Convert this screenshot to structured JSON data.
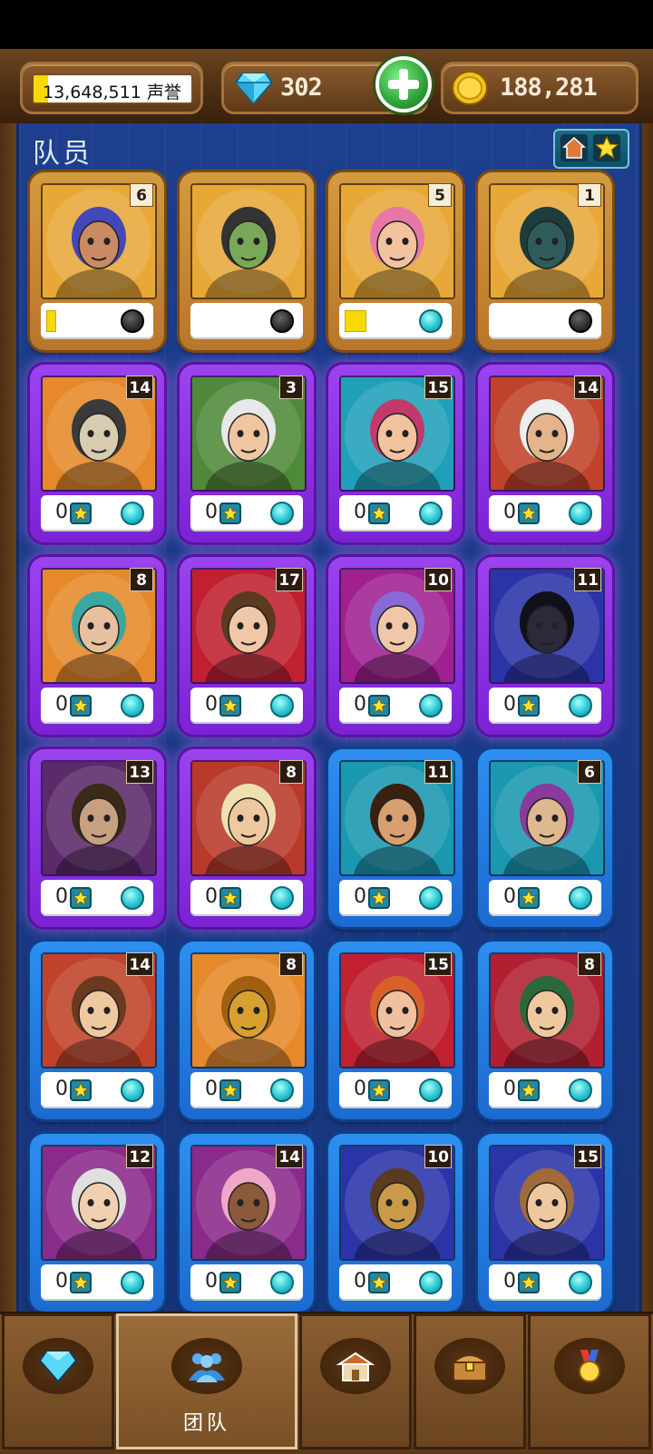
{
  "topbar": {
    "reputation": "13,648,511 声誉",
    "reputation_progress": 0.09,
    "gems": "302",
    "gold": "188,281",
    "icons": {
      "gem": "gem-icon",
      "gold": "gold-coin-icon",
      "plus": "plus-icon"
    }
  },
  "panel": {
    "title": "队员"
  },
  "filter": {
    "icons": [
      "home-icon",
      "star-icon"
    ]
  },
  "cards": [
    {
      "level": "6",
      "stars": "",
      "rarity": "gold",
      "progress": 0.14,
      "orb": "dark",
      "bg": "#e8a838",
      "skin": "#c98a64",
      "hair": "#4248b8"
    },
    {
      "level": "",
      "stars": "",
      "rarity": "gold",
      "progress": 0,
      "orb": "dark",
      "bg": "#e8a838",
      "skin": "#7aa85a",
      "hair": "#333"
    },
    {
      "level": "5",
      "stars": "",
      "rarity": "gold",
      "progress": 0.3,
      "orb": "cyan",
      "bg": "#e8a838",
      "skin": "#f3c3a0",
      "hair": "#e877a8"
    },
    {
      "level": "1",
      "stars": "",
      "rarity": "gold",
      "progress": 0,
      "orb": "dark",
      "bg": "#e8a838",
      "skin": "#2f5b5b",
      "hair": "#1e3c3c"
    },
    {
      "level": "14",
      "stars": "0",
      "rarity": "purple",
      "orb": "cyan",
      "bg": "#e5892a",
      "skin": "#d8ccb0",
      "hair": "#3a3a3a"
    },
    {
      "level": "3",
      "stars": "0",
      "rarity": "purple",
      "orb": "cyan",
      "bg": "#4f8a3a",
      "skin": "#f0c6a0",
      "hair": "#e8e8e8"
    },
    {
      "level": "15",
      "stars": "0",
      "rarity": "purple",
      "orb": "cyan",
      "bg": "#1fa0b8",
      "skin": "#f3c3a0",
      "hair": "#c23a6a"
    },
    {
      "level": "14",
      "stars": "0",
      "rarity": "purple",
      "orb": "cyan",
      "bg": "#c0422a",
      "skin": "#e6b48a",
      "hair": "#eee"
    },
    {
      "level": "8",
      "stars": "0",
      "rarity": "purple",
      "orb": "cyan",
      "bg": "#e5892a",
      "skin": "#e8c0a0",
      "hair": "#3aa8a0"
    },
    {
      "level": "17",
      "stars": "0",
      "rarity": "purple",
      "orb": "cyan",
      "bg": "#c02030",
      "skin": "#f0c8a8",
      "hair": "#5a3a20"
    },
    {
      "level": "10",
      "stars": "0",
      "rarity": "purple",
      "orb": "cyan",
      "bg": "#a02090",
      "skin": "#f0c8a8",
      "hair": "#8a6ad8"
    },
    {
      "level": "11",
      "stars": "0",
      "rarity": "purple",
      "orb": "cyan",
      "bg": "#2a34a8",
      "skin": "#2a2a3a",
      "hair": "#10101a"
    },
    {
      "level": "13",
      "stars": "0",
      "rarity": "purple",
      "orb": "cyan",
      "bg": "#5a2a6a",
      "skin": "#c8a080",
      "hair": "#3a2a1a"
    },
    {
      "level": "8",
      "stars": "0",
      "rarity": "purple",
      "orb": "cyan",
      "bg": "#b83a2a",
      "skin": "#f0c8a0",
      "hair": "#f0e0b0"
    },
    {
      "level": "11",
      "stars": "0",
      "rarity": "blue",
      "orb": "cyan",
      "bg": "#1a98b0",
      "skin": "#d8a070",
      "hair": "#3a2010"
    },
    {
      "level": "6",
      "stars": "0",
      "rarity": "blue",
      "orb": "cyan",
      "bg": "#1a98b0",
      "skin": "#e0b890",
      "hair": "#8a3a9a"
    },
    {
      "level": "14",
      "stars": "0",
      "rarity": "blue",
      "orb": "cyan",
      "bg": "#c0422a",
      "skin": "#f0c8a0",
      "hair": "#6a3a20"
    },
    {
      "level": "8",
      "stars": "0",
      "rarity": "blue",
      "orb": "cyan",
      "bg": "#e5892a",
      "skin": "#d8a030",
      "hair": "#a06010"
    },
    {
      "level": "15",
      "stars": "0",
      "rarity": "blue",
      "orb": "cyan",
      "bg": "#c02030",
      "skin": "#f0c0a0",
      "hair": "#d8602a"
    },
    {
      "level": "8",
      "stars": "0",
      "rarity": "blue",
      "orb": "cyan",
      "bg": "#b02030",
      "skin": "#f0c8a0",
      "hair": "#2a6a3a"
    },
    {
      "level": "12",
      "stars": "0",
      "rarity": "blue",
      "orb": "cyan",
      "bg": "#8a2a8a",
      "skin": "#f0d0b0",
      "hair": "#e0e0e0"
    },
    {
      "level": "14",
      "stars": "0",
      "rarity": "blue",
      "orb": "cyan",
      "bg": "#8a2a8a",
      "skin": "#8a5a3a",
      "hair": "#f0a8c8"
    },
    {
      "level": "10",
      "stars": "0",
      "rarity": "blue",
      "orb": "cyan",
      "bg": "#2a34a8",
      "skin": "#c89a4a",
      "hair": "#5a3a20"
    },
    {
      "level": "15",
      "stars": "0",
      "rarity": "blue",
      "orb": "cyan",
      "bg": "#2a34a8",
      "skin": "#f0c8a0",
      "hair": "#a06a3a"
    }
  ],
  "nav": [
    {
      "label": "",
      "icon": "gem-icon",
      "active": false
    },
    {
      "label": "团队",
      "icon": "team-icon",
      "active": true
    },
    {
      "label": "",
      "icon": "buildings-icon",
      "active": false
    },
    {
      "label": "",
      "icon": "treasure-chest-icon",
      "active": false
    },
    {
      "label": "",
      "icon": "medal-icon",
      "active": false
    }
  ]
}
